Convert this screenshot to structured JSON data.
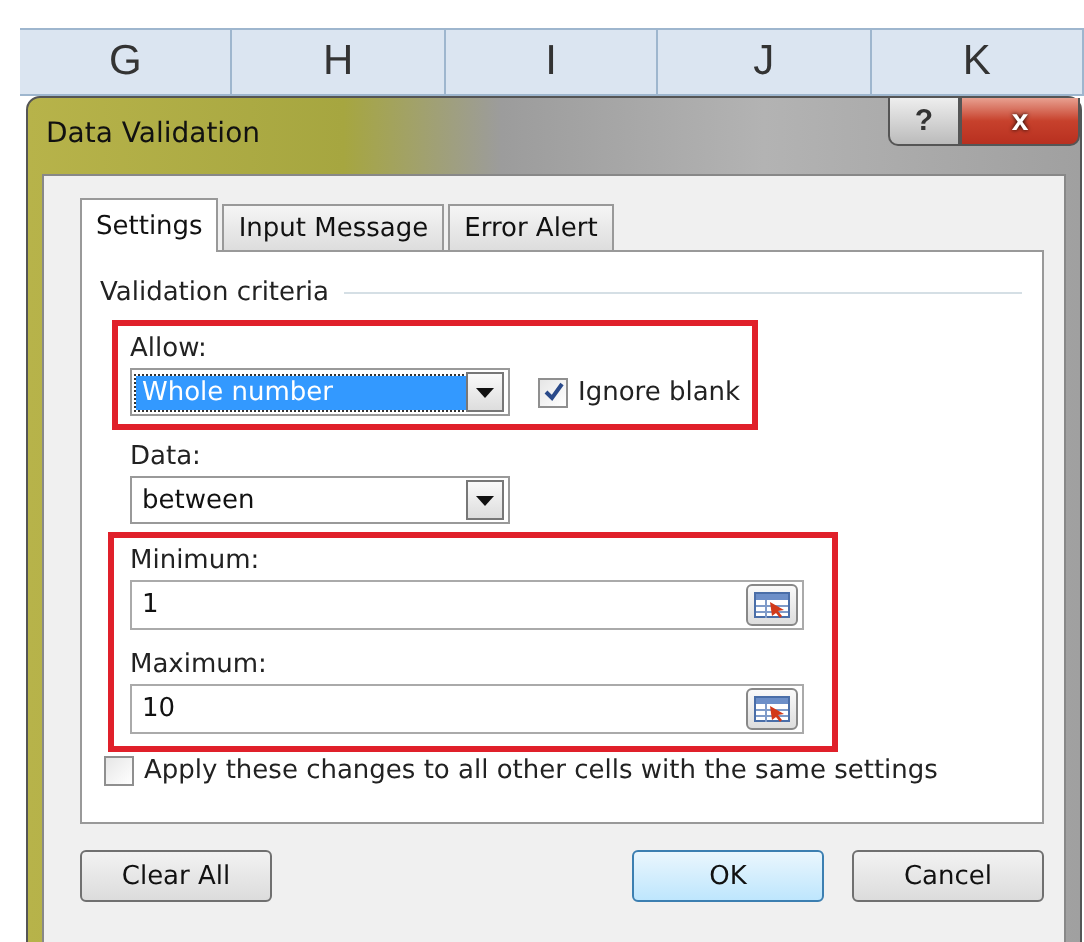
{
  "sheet": {
    "columns": [
      "G",
      "H",
      "I",
      "J",
      "K"
    ]
  },
  "dialog": {
    "title": "Data Validation",
    "title_buttons": [
      {
        "kind": "help",
        "label": "?"
      },
      {
        "kind": "close",
        "label": "x"
      }
    ]
  },
  "tabs": [
    {
      "label": "Settings",
      "selected": true
    },
    {
      "label": "Input Message",
      "selected": false
    },
    {
      "label": "Error Alert",
      "selected": false
    }
  ],
  "criteria": {
    "heading": "Validation criteria",
    "allow": {
      "highlight": true,
      "label": "Allow:",
      "value": "Whole number",
      "focused": true,
      "ignore_blank": {
        "label": "Ignore blank",
        "checked": true
      }
    },
    "data": {
      "label": "Data:",
      "value": "between"
    },
    "range": {
      "highlight": true,
      "fields": [
        {
          "label": "Minimum:",
          "value": "1"
        },
        {
          "label": "Maximum:",
          "value": "10"
        }
      ]
    },
    "apply_all": {
      "label": "Apply these changes to all other cells with the same settings",
      "checked": false
    }
  },
  "buttons": [
    {
      "label": "Clear All",
      "default": false
    },
    {
      "label": "OK",
      "default": true
    },
    {
      "label": "Cancel",
      "default": false
    }
  ]
}
